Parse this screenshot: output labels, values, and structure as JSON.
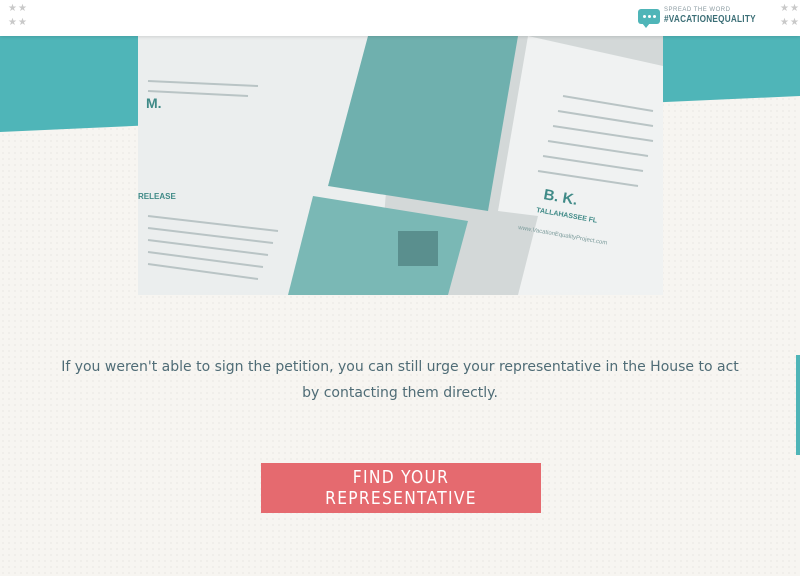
{
  "header": {
    "spread_label": "SPREAD THE WORD",
    "hashtag": "#VACATIONEQUALITY",
    "icon": "speech-bubble-icon"
  },
  "hero": {
    "card_initials_1": "M.",
    "card_initials_2": "B. K.",
    "card_city": "TALLAHASSEE FL",
    "card_url": "www.VacationEqualityProject.com",
    "card_heading": "RELEASE"
  },
  "main": {
    "body_text": "If you weren't able to sign the petition, you can still urge your representative in the House to act by contacting them directly.",
    "cta_label": "FIND YOUR REPRESENTATIVE"
  },
  "colors": {
    "teal": "#4fb5b8",
    "cta": "#e56a6f",
    "text": "#4f6c76"
  }
}
